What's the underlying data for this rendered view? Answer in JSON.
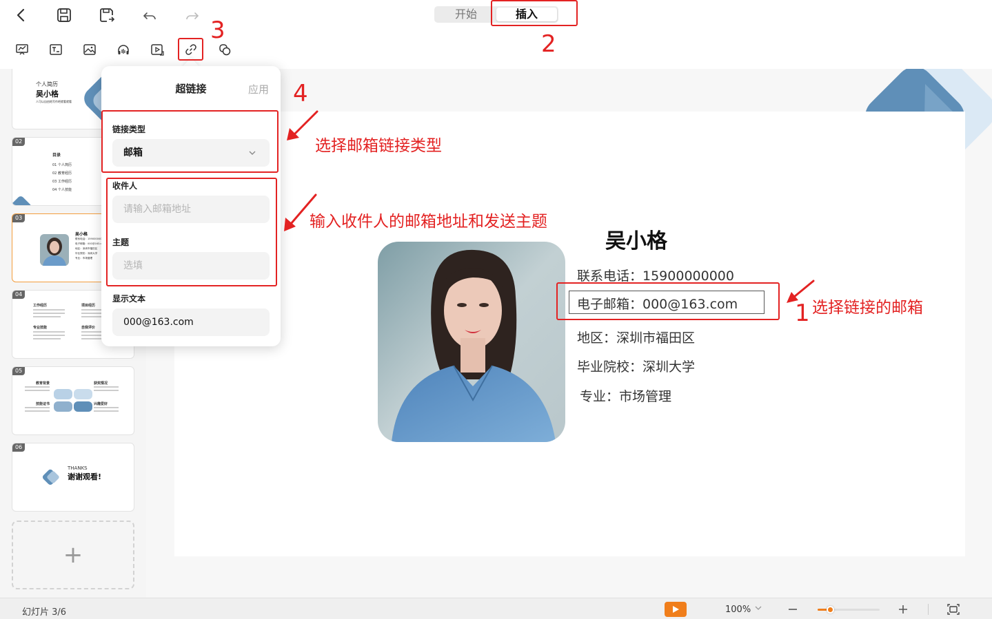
{
  "toolbar": {
    "tabs": [
      {
        "label": "开始",
        "active": false
      },
      {
        "label": "插入",
        "active": true
      }
    ],
    "icons": [
      "back-icon",
      "save-icon",
      "save-as-icon",
      "undo-icon",
      "redo-icon"
    ],
    "insert_tools": [
      "chart-icon",
      "textbox-icon",
      "image-icon",
      "audio-icon",
      "video-icon",
      "link-icon",
      "shape-icon"
    ]
  },
  "thumbnails": {
    "slides": [
      {
        "num": "",
        "title_small": "个人简历",
        "title": "吴小格",
        "sub": "人可以自由地写作吧就看就看"
      },
      {
        "num": "02",
        "title": "目录",
        "items": [
          "01 个人简历",
          "02 教育经历",
          "03 工作经历",
          "04 个人技能"
        ]
      },
      {
        "num": "03",
        "title": "吴小格",
        "lines": [
          "联系电话：15900000000",
          "电子邮箱：000@163.com",
          "地区：深圳市福田区",
          "毕业院校：深圳大学",
          "专业：市场管理"
        ]
      },
      {
        "num": "04",
        "heads": [
          "工作经历",
          "项目经历",
          "专业技能",
          "自我评价"
        ]
      },
      {
        "num": "05",
        "heads": [
          "教育背景",
          "获奖情况",
          "技能证书",
          "兴趣爱好"
        ]
      },
      {
        "num": "06",
        "small": "THANKS",
        "big": "谢谢观看!"
      }
    ],
    "add_label": "+"
  },
  "slide": {
    "name": "吴小格",
    "phone": "联系电话：15900000000",
    "email": "电子邮箱：000@163.com",
    "region": "地区：深圳市福田区",
    "school": "毕业院校：深圳大学",
    "major": "专业：市场管理"
  },
  "hyperlink_popover": {
    "title": "超链接",
    "apply_label": "应用",
    "link_type_label": "链接类型",
    "link_type_value": "邮箱",
    "recipient_label": "收件人",
    "recipient_placeholder": "请输入邮箱地址",
    "subject_label": "主题",
    "subject_placeholder": "选填",
    "display_text_label": "显示文本",
    "display_text_value": "000@163.com"
  },
  "statusbar": {
    "slide_counter": "幻灯片 3/6",
    "zoom": "100%",
    "zoom_fraction": 0.2
  },
  "annotations": {
    "step1": "1",
    "step2": "2",
    "step3": "3",
    "step4": "4",
    "note_select_email_type": "选择邮箱链接类型",
    "note_input_recipient": "输入收件人的邮箱地址和发送主题",
    "note_select_linked_email": "选择链接的邮箱",
    "accent": "#e32222"
  },
  "colors": {
    "brand_orange": "#f07e1b",
    "slide_blue": "#5f8fb8"
  }
}
